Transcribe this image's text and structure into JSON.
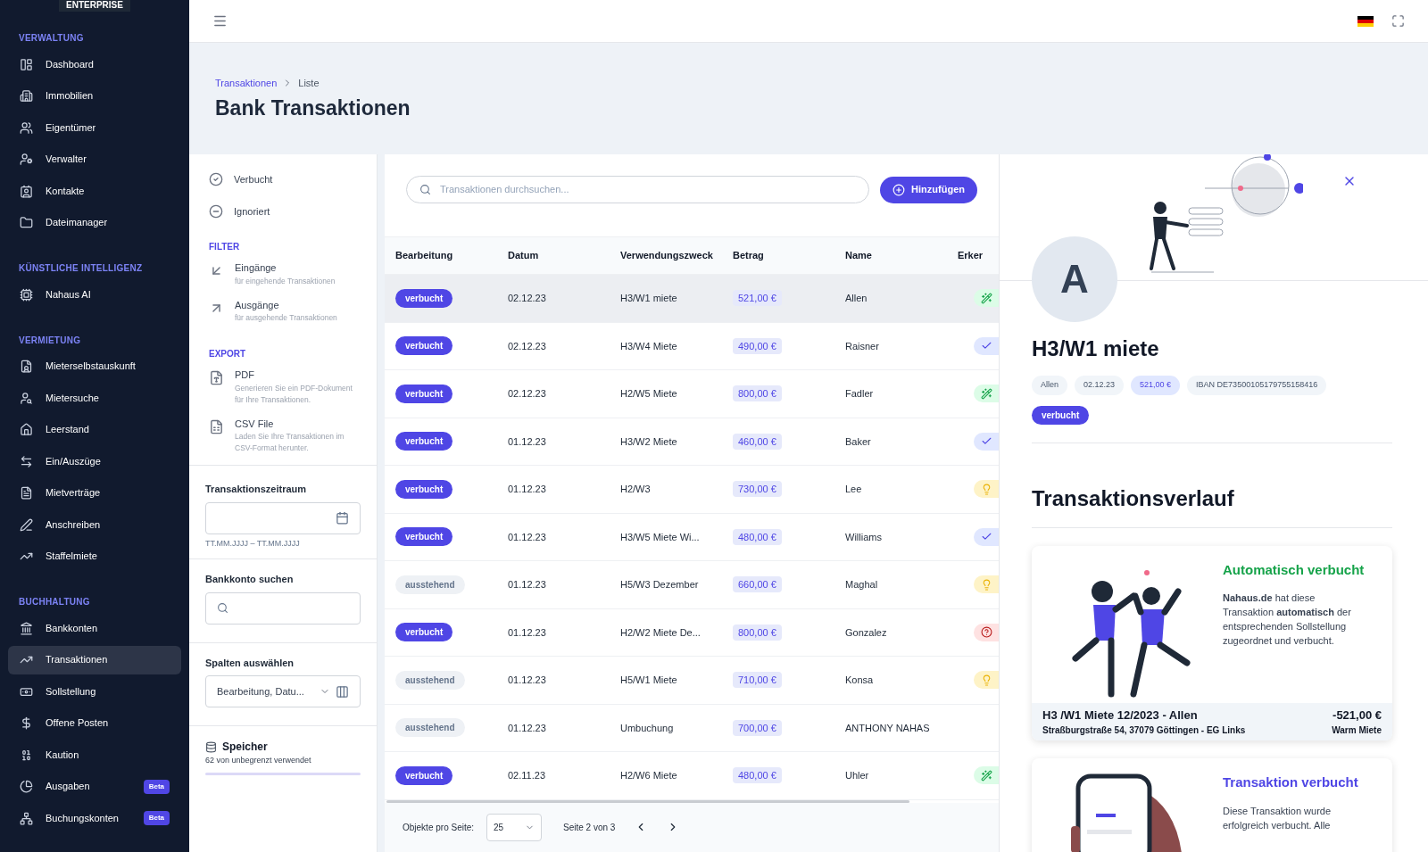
{
  "sidebar": {
    "badge": "ENTERPRISE",
    "sections": [
      {
        "title": "VERWALTUNG",
        "items": [
          {
            "label": "Dashboard",
            "selected": false
          },
          {
            "label": "Immobilien",
            "selected": false
          },
          {
            "label": "Eigentümer",
            "selected": false
          },
          {
            "label": "Verwalter",
            "selected": false
          },
          {
            "label": "Kontakte",
            "selected": false
          },
          {
            "label": "Dateimanager",
            "selected": false
          }
        ]
      },
      {
        "title": "KÜNSTLICHE INTELLIGENZ",
        "items": [
          {
            "label": "Nahaus AI",
            "selected": false
          }
        ]
      },
      {
        "title": "VERMIETUNG",
        "items": [
          {
            "label": "Mieterselbstauskunft",
            "selected": false
          },
          {
            "label": "Mietersuche",
            "selected": false
          },
          {
            "label": "Leerstand",
            "selected": false
          },
          {
            "label": "Ein/Auszüge",
            "selected": false
          },
          {
            "label": "Mietverträge",
            "selected": false
          },
          {
            "label": "Anschreiben",
            "selected": false
          },
          {
            "label": "Staffelmiete",
            "selected": false
          }
        ]
      },
      {
        "title": "BUCHHALTUNG",
        "items": [
          {
            "label": "Bankkonten",
            "selected": false
          },
          {
            "label": "Transaktionen",
            "selected": true
          },
          {
            "label": "Sollstellung",
            "selected": false
          },
          {
            "label": "Offene Posten",
            "selected": false
          },
          {
            "label": "Kaution",
            "selected": false
          },
          {
            "label": "Ausgaben",
            "selected": false,
            "badge": "Beta"
          },
          {
            "label": "Buchungskonten",
            "selected": false,
            "badge": "Beta"
          }
        ]
      }
    ]
  },
  "breadcrumb": [
    "Transaktionen",
    "Liste"
  ],
  "page_title": "Bank Transaktionen",
  "status_filters": [
    {
      "label": "Verbucht"
    },
    {
      "label": "Ignoriert"
    }
  ],
  "filter": {
    "title": "FILTER",
    "items": [
      {
        "label": "Eingänge",
        "subtitle": "für eingehende Transaktionen"
      },
      {
        "label": "Ausgänge",
        "subtitle": "für ausgehende Transaktionen"
      }
    ]
  },
  "export": {
    "title": "EXPORT",
    "items": [
      {
        "label": "PDF",
        "subtitle": "Generieren Sie ein PDF-Dokument für Ihre Transaktionen."
      },
      {
        "label": "CSV File",
        "subtitle": "Laden Sie Ihre Transaktionen im CSV-Format herunter."
      }
    ]
  },
  "date_range": {
    "label": "Transaktionszeitraum",
    "hint": "TT.MM.JJJJ – TT.MM.JJJJ"
  },
  "bank_search": {
    "label": "Bankkonto suchen"
  },
  "columns_select": {
    "label": "Spalten auswählen",
    "value": "Bearbeitung, Datu..."
  },
  "storage": {
    "title": "Speicher",
    "text": "62 von unbegrenzt verwendet"
  },
  "search": {
    "placeholder": "Transaktionen durchsuchen..."
  },
  "add_button": "Hinzufügen",
  "table": {
    "columns": [
      "Bearbeitung",
      "Datum",
      "Verwendungszweck",
      "Betrag",
      "Name",
      "Erker"
    ],
    "rows": [
      {
        "status": "verbucht",
        "booked": true,
        "date": "02.12.23",
        "purpose": "H3/W1 miete",
        "amount": "521,00 €",
        "name": "Allen",
        "indicator": {
          "kind": "auto"
        },
        "selected": true
      },
      {
        "status": "verbucht",
        "booked": true,
        "date": "02.12.23",
        "purpose": "H3/W4 Miete",
        "amount": "490,00 €",
        "name": "Raisner",
        "indicator": {
          "kind": "check"
        },
        "selected": false
      },
      {
        "status": "verbucht",
        "booked": true,
        "date": "02.12.23",
        "purpose": "H2/W5 Miete",
        "amount": "800,00 €",
        "name": "Fadler",
        "indicator": {
          "kind": "auto"
        },
        "selected": false
      },
      {
        "status": "verbucht",
        "booked": true,
        "date": "01.12.23",
        "purpose": "H3/W2 Miete",
        "amount": "460,00 €",
        "name": "Baker",
        "indicator": {
          "kind": "check"
        },
        "selected": false
      },
      {
        "status": "verbucht",
        "booked": true,
        "date": "01.12.23",
        "purpose": "H2/W3",
        "amount": "730,00 €",
        "name": "Lee",
        "indicator": {
          "kind": "hint"
        },
        "selected": false
      },
      {
        "status": "verbucht",
        "booked": true,
        "date": "01.12.23",
        "purpose": "H3/W5 Miete Wi...",
        "amount": "480,00 €",
        "name": "Williams",
        "indicator": {
          "kind": "check"
        },
        "selected": false
      },
      {
        "status": "ausstehend",
        "booked": false,
        "date": "01.12.23",
        "purpose": "H5/W3 Dezember",
        "amount": "660,00 €",
        "name": "Maghal",
        "indicator": {
          "kind": "hint"
        },
        "selected": false
      },
      {
        "status": "verbucht",
        "booked": true,
        "date": "01.12.23",
        "purpose": "H2/W2 Miete De...",
        "amount": "800,00 €",
        "name": "Gonzalez",
        "indicator": {
          "kind": "unknown"
        },
        "selected": false
      },
      {
        "status": "ausstehend",
        "booked": false,
        "date": "01.12.23",
        "purpose": "H5/W1 Miete",
        "amount": "710,00 €",
        "name": "Konsa",
        "indicator": {
          "kind": "hint"
        },
        "selected": false
      },
      {
        "status": "ausstehend",
        "booked": false,
        "date": "01.12.23",
        "purpose": "Umbuchung",
        "amount": "700,00 €",
        "name": "ANTHONY NAHAS",
        "selected": false
      },
      {
        "status": "verbucht",
        "booked": true,
        "date": "02.11.23",
        "purpose": "H2/W6 Miete",
        "amount": "480,00 €",
        "name": "Uhler",
        "indicator": {
          "kind": "auto"
        },
        "selected": false
      }
    ]
  },
  "pagination": {
    "label": "Objekte pro Seite:",
    "per_page": "25",
    "page": "Seite 2 von 3"
  },
  "detail": {
    "avatar": "A",
    "title": "H3/W1 miete",
    "booked": true,
    "chips": [
      {
        "text": "Allen",
        "highlight": false
      },
      {
        "text": "02.12.23",
        "highlight": false
      },
      {
        "text": "521,00 €",
        "highlight": true
      },
      {
        "text": "IBAN DE73500105179755158416",
        "highlight": false
      }
    ],
    "status": "verbucht",
    "history_title": "Transaktionsverlauf",
    "cards": [
      {
        "kind": "auto",
        "title": "Automatisch verbucht",
        "text": "**Nahaus.de** hat diese Transaktion **automatisch** der entsprechenden Sollstellung zugeordnet und verbucht.",
        "footer": {
          "title": "H3 /W1 Miete 12/2023 - Allen",
          "amount": "-521,00 €",
          "address": "Straßburgstraße 54, 37079 Göttingen - EG Links",
          "category": "Warm Miete"
        }
      },
      {
        "kind": "booked",
        "title": "Transaktion verbucht",
        "text": "Diese Transaktion wurde erfolgreich verbucht. Alle"
      }
    ]
  }
}
